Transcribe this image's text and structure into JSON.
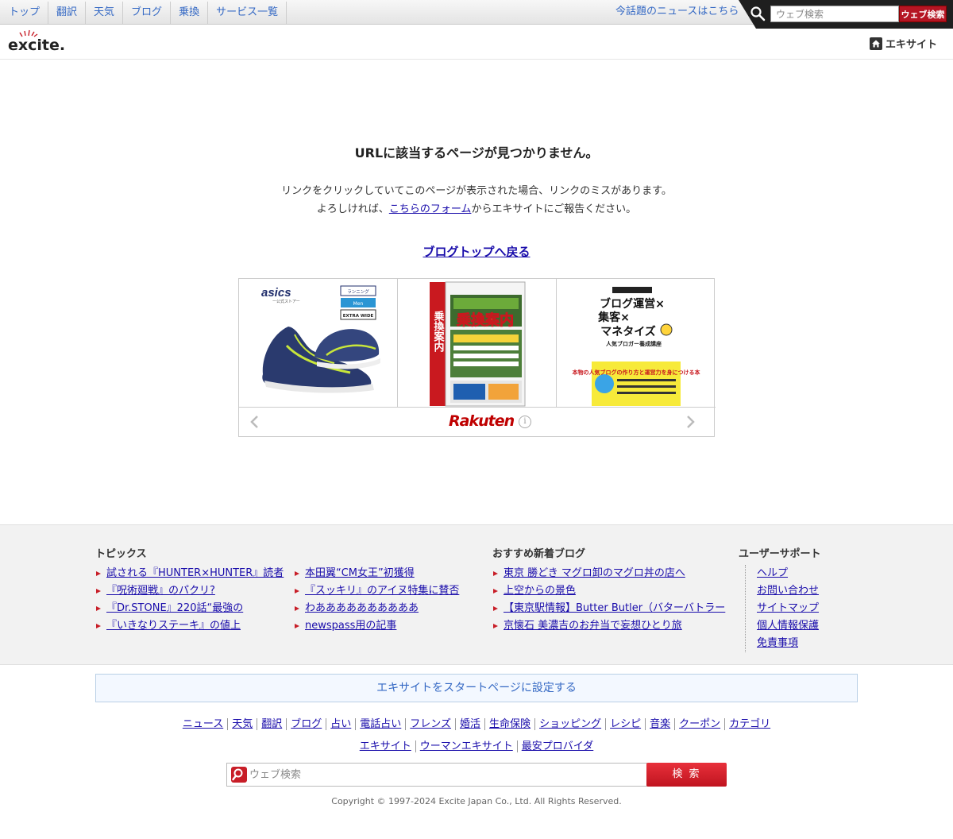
{
  "topnav": {
    "items": [
      "トップ",
      "翻訳",
      "天気",
      "ブログ",
      "乗換",
      "サービス一覧"
    ],
    "news_link": "今話題のニュースはこちら",
    "search_placeholder": "ウェブ検索",
    "search_button": "ウェブ検索"
  },
  "header": {
    "logo_text": "excite.",
    "home_link": "エキサイト"
  },
  "main": {
    "title": "URLに該当するページが見つかりません。",
    "desc_line1": "リンクをクリックしていてこのページが表示された場合、リンクのミスがあります。",
    "desc_line2_pre": "よろしければ、",
    "desc_line2_link": "こちらのフォーム",
    "desc_line2_post": "からエキサイトにご報告ください。",
    "back_link": "ブログトップへ戻る"
  },
  "ad": {
    "products": [
      {
        "brand": "asics",
        "brand_sub": "ー公式ストアー",
        "tags": [
          "ランニング",
          "Men",
          "EXTRA WIDE"
        ]
      },
      {
        "title": "乗換案内",
        "sub": "乗換案内"
      },
      {
        "title_lines": [
          "ブログ運営×",
          "集客×",
          "マネタイズ"
        ],
        "sub": "人気ブロガー養成講座",
        "band": "本物の人気ブログの作り方と運営力を身につける本"
      }
    ],
    "logo": "Rakuten",
    "info_icon": "i"
  },
  "footer": {
    "topics": {
      "heading": "トピックス",
      "col1": [
        "試される『HUNTER×HUNTER』読者",
        "『呪術廻戦』のパクリ?",
        "『Dr.STONE』220話“最強の",
        "『いきなりステーキ』の値上"
      ],
      "col2": [
        "本田翼“CM女王”初獲得",
        "『スッキリ』のアイヌ特集に賛否",
        "わああああああああああ",
        "newspass用の記事"
      ]
    },
    "blogs": {
      "heading": "おすすめ新着ブログ",
      "items": [
        "東京 勝どき マグロ卸のマグロ丼の店へ",
        "上空からの景色",
        "【東京駅情報】Butter Butler（バターバトラー",
        "京懐石 美濃吉のお弁当で妄想ひとり旅"
      ]
    },
    "support": {
      "heading": "ユーザーサポート",
      "items": [
        "ヘルプ",
        "お問い合わせ",
        "サイトマップ",
        "個人情報保護",
        "免責事項"
      ]
    }
  },
  "start_page": "エキサイトをスタートページに設定する",
  "links_row1": [
    "ニュース",
    "天気",
    "翻訳",
    "ブログ",
    "占い",
    "電話占い",
    "フレンズ",
    "婚活",
    "生命保険",
    "ショッピング",
    "レシピ",
    "音楽",
    "クーポン",
    "カテゴリ"
  ],
  "links_row2": [
    "エキサイト",
    "ウーマンエキサイト",
    "最安プロバイダ"
  ],
  "bottom_search": {
    "placeholder": "ウェブ検索",
    "button": "検 索"
  },
  "copyright": "Copyright © 1997-2024 Excite Japan Co., Ltd. All Rights Reserved.",
  "colors": {
    "accent_red": "#c81e28",
    "link_blue": "#1a0dab",
    "nav_blue": "#3569c4"
  }
}
